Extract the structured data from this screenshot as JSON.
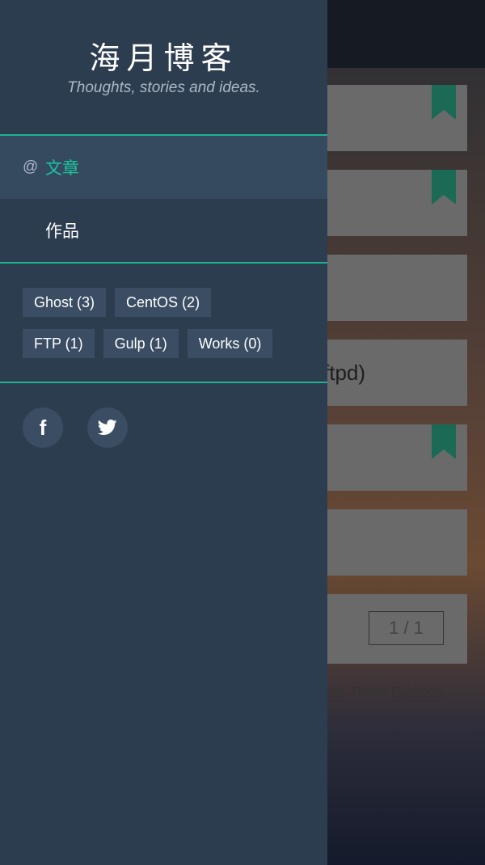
{
  "site": {
    "title": "海月博客",
    "description": "Thoughts, stories and ideas."
  },
  "nav": {
    "items": [
      {
        "prefix": "@",
        "label": "文章",
        "active": true
      },
      {
        "prefix": "",
        "label": "作品",
        "active": false
      }
    ]
  },
  "tags": [
    {
      "label": "Ghost (3)"
    },
    {
      "label": "CentOS (2)"
    },
    {
      "label": "FTP (1)"
    },
    {
      "label": "Gulp (1)"
    },
    {
      "label": "Works (0)"
    }
  ],
  "social": [
    {
      "icon": "facebook-icon"
    },
    {
      "icon": "twitter-icon"
    }
  ],
  "background": {
    "card_text": "ftpd)",
    "pagination": "1 / 1",
    "footer": {
      "prefix": "ost",
      "middle": ". Theme ",
      "theme_link": "FlatGhost",
      "suffix": "."
    }
  },
  "colors": {
    "drawer_bg": "#2d3d50",
    "accent": "#1bb394",
    "active_label": "#1bc6a0",
    "tag_bg": "#3a4d62"
  }
}
